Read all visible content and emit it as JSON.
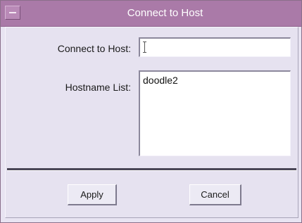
{
  "window": {
    "title": "Connect to Host"
  },
  "form": {
    "host_label": "Connect to Host:",
    "host_value": "",
    "list_label": "Hostname List:",
    "hostnames": [
      "doodle2"
    ]
  },
  "buttons": {
    "apply_label": "Apply",
    "cancel_label": "Cancel"
  },
  "icons": {
    "window_menu": "window-menu-icon"
  },
  "colors": {
    "titlebar": "#aa7aa8",
    "background": "#e6e2f0"
  }
}
